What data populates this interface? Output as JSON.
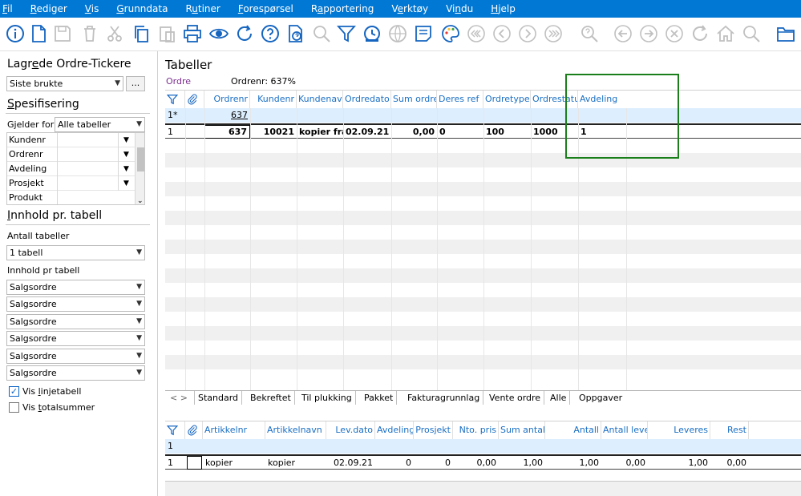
{
  "menu": [
    {
      "pre": "",
      "u": "F",
      "post": "il"
    },
    {
      "pre": "",
      "u": "R",
      "post": "ediger"
    },
    {
      "pre": "",
      "u": "V",
      "post": "is"
    },
    {
      "pre": "",
      "u": "G",
      "post": "runndata"
    },
    {
      "pre": "R",
      "u": "u",
      "post": "tiner"
    },
    {
      "pre": "",
      "u": "F",
      "post": "orespørsel"
    },
    {
      "pre": "R",
      "u": "a",
      "post": "pportering"
    },
    {
      "pre": "V",
      "u": "e",
      "post": "rktøy"
    },
    {
      "pre": "Vi",
      "u": "n",
      "post": "du"
    },
    {
      "pre": "",
      "u": "H",
      "post": "jelp"
    }
  ],
  "toolbar_icons": [
    "info-icon",
    "new-document-icon",
    "save-icon",
    "delete-icon",
    "cut-icon",
    "copy-icon",
    "paste-icon",
    "print-icon",
    "preview-icon",
    "refresh-icon",
    "help-icon",
    "query-icon",
    "search-icon",
    "filter-icon",
    "history-icon",
    "globe-icon",
    "note-icon",
    "palette-icon",
    "first-icon",
    "previous-icon",
    "next-icon",
    "last-icon",
    "find-icon",
    "back-icon",
    "forward-icon",
    "stop-icon",
    "reload-icon",
    "home-icon",
    "zoom-icon",
    "folder-icon"
  ],
  "left": {
    "saved_title_pre": "Lagr",
    "saved_title_u": "e",
    "saved_title_post": "de Ordre-Tickere",
    "saved_value": "Siste brukte",
    "more_btn": "...",
    "spec_title_u": "S",
    "spec_title_post": "pesifisering",
    "applies_label": "Gjelder for",
    "applies_value": "Alle tabeller",
    "spec_rows": [
      "Kundenr",
      "Ordrenr",
      "Avdeling",
      "Prosjekt",
      "Produkt"
    ],
    "content_title_u": "I",
    "content_title_post": "nnhold pr. tabell",
    "count_label": "Antall tabeller",
    "count_value": "1 tabell",
    "per_table_label": "Innhold pr tabell",
    "per_table_values": [
      "Salgsordre",
      "Salgsordre",
      "Salgsordre",
      "Salgsordre",
      "Salgsordre",
      "Salgsordre"
    ],
    "chk_line_pre": "Vis ",
    "chk_line_u": "l",
    "chk_line_post": "injetabell",
    "chk_total_pre": "Vis ",
    "chk_total_u": "t",
    "chk_total_post": "otalsummer"
  },
  "right": {
    "title": "Tabeller",
    "table_name": "Ordre",
    "ordrenr_text": "Ordrenr: 637%",
    "headers": [
      "Ordrenr",
      "Kundenr",
      "Kundenavn",
      "Ordredato",
      "Sum ordre",
      "Deres ref",
      "Ordretype",
      "Ordrestatus",
      "Avdeling"
    ],
    "filter_row": {
      "num": "1*",
      "ordrenr": "637"
    },
    "data_row": {
      "num": "1",
      "ordrenr": "637",
      "kundenr": "10021",
      "kundenavn": "kopier fra",
      "ordredato": "02.09.21",
      "sum": "0,00",
      "ref": "0",
      "type": "100",
      "status": "1000",
      "avdeling": "1"
    },
    "tabs": [
      "Standard",
      "Bekreftet",
      "Til plukking",
      "Pakket",
      "Fakturagrunnlag",
      "Vente ordre",
      "Alle",
      "Oppgaver"
    ],
    "tab_nav": "< >",
    "lines_headers": [
      "Artikkelnr",
      "Artikkelnavn",
      "Lev.dato",
      "Avdeling",
      "Prosjekt",
      "Nto. pris",
      "Sum antall",
      "Antall",
      "Antall lever",
      "Leveres",
      "Rest"
    ],
    "lines_filter_num": "1",
    "line_row": {
      "num": "1",
      "artnr": "kopier",
      "artnavn": "kopier",
      "levdato": "02.09.21",
      "avd": "0",
      "prosj": "0",
      "pris": "0,00",
      "sumant": "1,00",
      "antall": "1,00",
      "antlev": "0,00",
      "leveres": "1,00",
      "rest": "0,00"
    }
  },
  "colors": {
    "menubar": "#0078d4",
    "header_text": "#1a6fc4",
    "highlight": "#1a7f1a",
    "table_name": "#7a2e8e"
  }
}
